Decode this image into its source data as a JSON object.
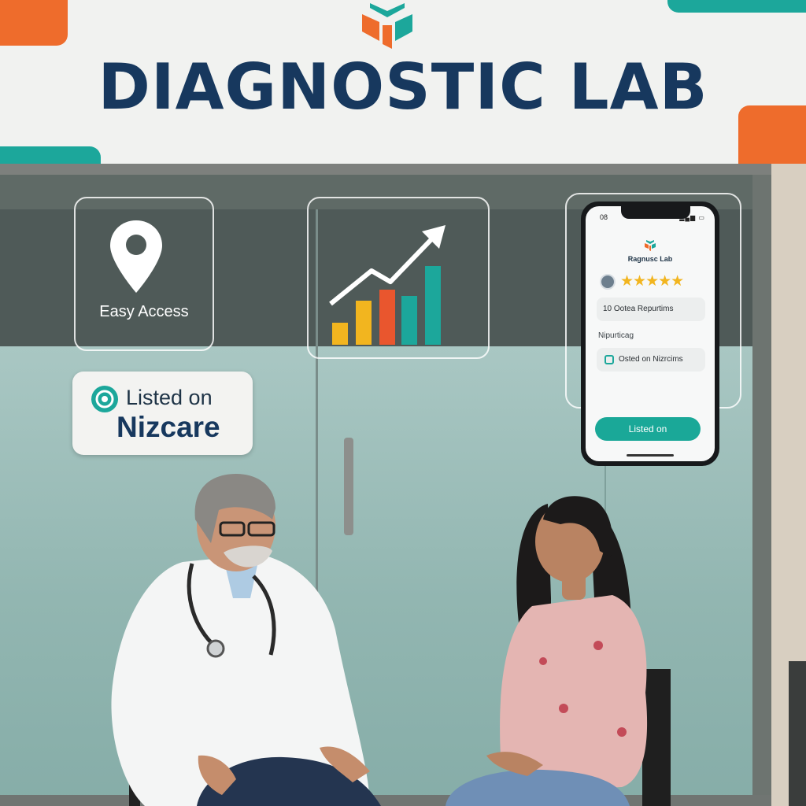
{
  "sign": {
    "title": "DIAGNOSTIC LAB"
  },
  "cards": {
    "access_label": "Easy Access"
  },
  "badge": {
    "line1": "Listed on",
    "line2": "Nizcare"
  },
  "phone": {
    "time": "08",
    "app_title": "Ragnusc Lab",
    "stars": "★★★★★",
    "row1_text": "10 Ootea Repurtims",
    "section_label": "Nipurticag",
    "row2_text": "Osted on Nizrcims",
    "cta_label": "Listed on"
  },
  "colors": {
    "brand_navy": "#17385e",
    "accent_orange": "#ee6c2c",
    "accent_teal": "#1ca79b",
    "chart_yellow": "#f2b51f",
    "chart_red": "#e9562e"
  }
}
